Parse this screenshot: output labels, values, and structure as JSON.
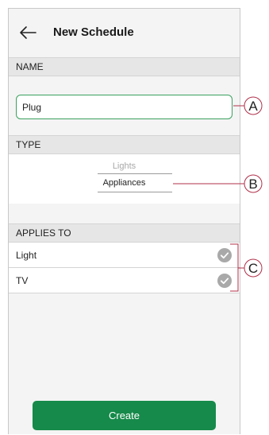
{
  "header": {
    "title": "New Schedule",
    "back_icon": "arrow-left-icon"
  },
  "name_section": {
    "label": "NAME",
    "input_value": "Plug"
  },
  "type_section": {
    "label": "TYPE",
    "options": [
      "Lights",
      "Appliances"
    ],
    "selected": "Appliances"
  },
  "applies_to": {
    "label": "APPLIES TO",
    "items": [
      {
        "label": "Light",
        "icon": "check-circle-icon"
      },
      {
        "label": "TV",
        "icon": "check-circle-icon"
      }
    ]
  },
  "create_button": {
    "label": "Create"
  },
  "callouts": [
    "A",
    "B",
    "C"
  ],
  "colors": {
    "accent": "#168a4a",
    "input_border": "#3aa15f",
    "callout": "#b0304a"
  }
}
